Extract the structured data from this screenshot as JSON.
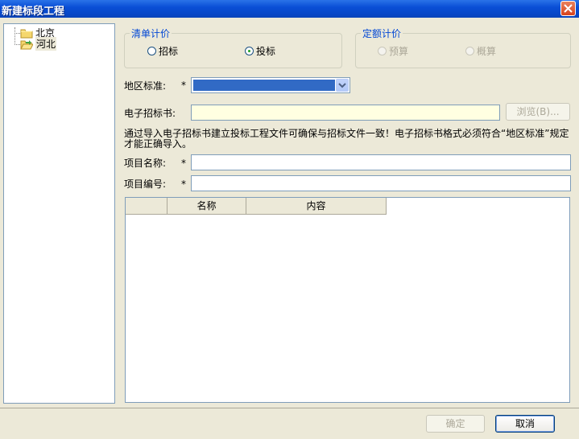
{
  "window": {
    "title": "新建标段工程"
  },
  "tree": {
    "items": [
      {
        "label": "北京",
        "icon": "folder-icon"
      },
      {
        "label": "河北",
        "icon": "folder-open-icon",
        "selected": true
      }
    ]
  },
  "pricing_list": {
    "legend": "清单计价",
    "options": [
      {
        "label": "招标",
        "checked": false
      },
      {
        "label": "投标",
        "checked": true
      }
    ]
  },
  "pricing_quota": {
    "legend": "定额计价",
    "disabled": true,
    "options": [
      {
        "label": "预算",
        "checked": false
      },
      {
        "label": "概算",
        "checked": false
      }
    ]
  },
  "form": {
    "region_label": "地区标准:",
    "region_value": "",
    "ebid_label": "电子招标书:",
    "ebid_value": "",
    "browse_label": "浏览(B)...",
    "note": "通过导入电子招标书建立投标工程文件可确保与招标文件一致！电子招标书格式必须符合“地区标准”规定才能正确导入。",
    "project_name_label": "项目名称:",
    "project_name_value": "",
    "project_code_label": "项目编号:",
    "project_code_value": "",
    "required_mark": "*"
  },
  "grid": {
    "columns": [
      "",
      "名称",
      "内容"
    ]
  },
  "footer": {
    "ok_label": "确定",
    "cancel_label": "取消"
  }
}
